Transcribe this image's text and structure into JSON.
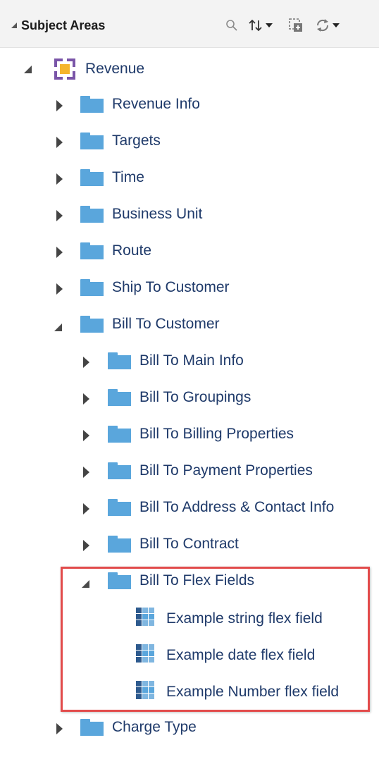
{
  "header": {
    "title": "Subject Areas",
    "tools": [
      "search-icon",
      "sort-icon",
      "add-to-canvas-icon",
      "refresh-icon"
    ]
  },
  "tree": {
    "root": {
      "label": "Revenue",
      "children": [
        {
          "label": "Revenue Info"
        },
        {
          "label": "Targets"
        },
        {
          "label": "Time"
        },
        {
          "label": "Business Unit"
        },
        {
          "label": "Route"
        },
        {
          "label": "Ship To Customer"
        },
        {
          "label": "Bill To Customer",
          "children": [
            {
              "label": "Bill To Main Info"
            },
            {
              "label": "Bill To Groupings"
            },
            {
              "label": "Bill To Billing Properties"
            },
            {
              "label": "Bill To Payment Properties"
            },
            {
              "label": "Bill To Address & Contact Info"
            },
            {
              "label": "Bill To Contract"
            },
            {
              "label": "Bill To Flex Fields",
              "children": [
                {
                  "label": "Example string flex field"
                },
                {
                  "label": "Example date flex field"
                },
                {
                  "label": "Example Number flex field"
                }
              ]
            }
          ]
        },
        {
          "label": "Charge Type"
        }
      ]
    }
  },
  "colors": {
    "folder": "#5aa6dc",
    "text": "#1f3a6a",
    "highlight_border": "#e24b4b",
    "subject_area_orange": "#f5b52c",
    "subject_area_purple": "#7a55a8"
  }
}
